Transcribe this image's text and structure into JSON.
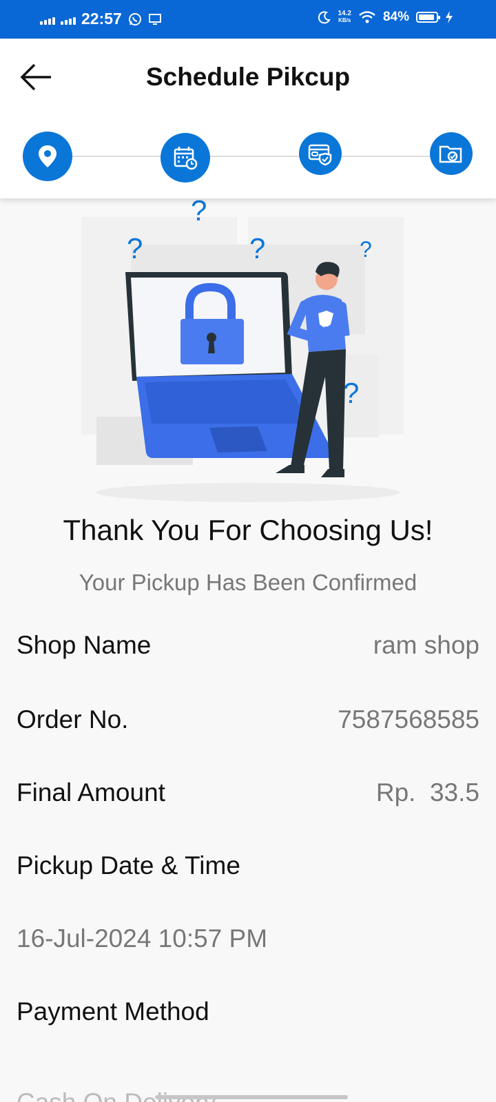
{
  "status_bar": {
    "time": "22:57",
    "net_speed_value": "14.2",
    "net_speed_unit": "KB/s",
    "battery": "84%",
    "battery_level": 0.84
  },
  "header": {
    "title": "Schedule Pikcup",
    "steps": [
      {
        "icon": "location-pin-icon"
      },
      {
        "icon": "calendar-clock-icon"
      },
      {
        "icon": "payment-card-shield-icon"
      },
      {
        "icon": "folder-check-icon"
      }
    ]
  },
  "confirmation": {
    "title": "Thank You For Choosing Us!",
    "subtitle": "Your Pickup Has Been Confirmed"
  },
  "details": {
    "shop_name_label": "Shop Name",
    "shop_name_value": "ram shop",
    "order_no_label": "Order No.",
    "order_no_value": "7587568585",
    "final_amount_label": "Final Amount",
    "final_amount_value": "Rp.  33.5",
    "pickup_label": "Pickup Date & Time",
    "pickup_value": "16-Jul-2024 10:57 PM",
    "payment_label": "Payment Method",
    "payment_value": "Cash On Delivery"
  },
  "colors": {
    "status_bar": "#0a67d6",
    "accent": "#0a76d8",
    "illustration_blue": "#4a7cf0"
  }
}
